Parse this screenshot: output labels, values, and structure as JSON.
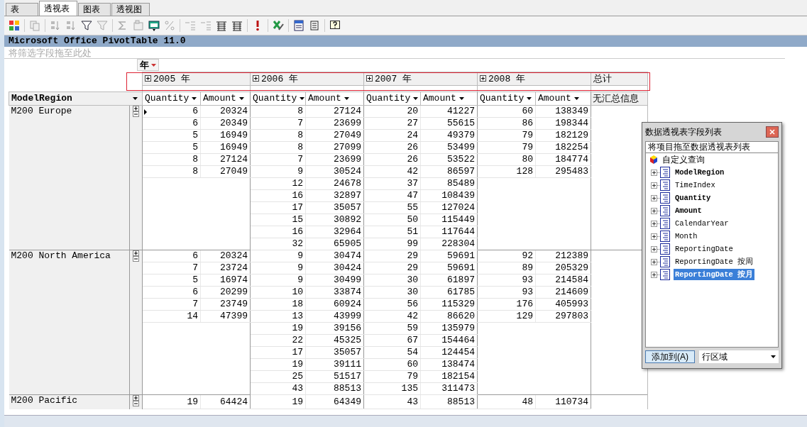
{
  "tabs": [
    {
      "label": "表",
      "selected": false
    },
    {
      "label": "透视表",
      "selected": true
    },
    {
      "label": "图表",
      "selected": false
    },
    {
      "label": "透视图",
      "selected": false
    }
  ],
  "pivot": {
    "title": "Microsoft Office PivotTable 11.0",
    "filter_placeholder": "将筛选字段拖至此处",
    "column_field": "年",
    "years": [
      {
        "label": "2005 年",
        "measures": [
          "Quantity",
          "Amount"
        ]
      },
      {
        "label": "2006 年",
        "measures": [
          "Quantity",
          "Amount"
        ]
      },
      {
        "label": "2007 年",
        "measures": [
          "Quantity",
          "Amount"
        ]
      },
      {
        "label": "2008 年",
        "measures": [
          "Quantity",
          "Amount"
        ]
      }
    ],
    "total_label": "总计",
    "row_field": "ModelRegion",
    "no_total": "无汇总信息",
    "groups": [
      {
        "region": "M200 Europe",
        "rows": [
          [
            [
              "6",
              "20324"
            ],
            [
              "8",
              "27124"
            ],
            [
              "20",
              "41227"
            ],
            [
              "60",
              "138349"
            ]
          ],
          [
            [
              "6",
              "20349"
            ],
            [
              "7",
              "23699"
            ],
            [
              "27",
              "55615"
            ],
            [
              "86",
              "198344"
            ]
          ],
          [
            [
              "5",
              "16949"
            ],
            [
              "8",
              "27049"
            ],
            [
              "24",
              "49379"
            ],
            [
              "79",
              "182129"
            ]
          ],
          [
            [
              "5",
              "16949"
            ],
            [
              "8",
              "27099"
            ],
            [
              "26",
              "53499"
            ],
            [
              "79",
              "182254"
            ]
          ],
          [
            [
              "8",
              "27124"
            ],
            [
              "7",
              "23699"
            ],
            [
              "26",
              "53522"
            ],
            [
              "80",
              "184774"
            ]
          ],
          [
            [
              "8",
              "27049"
            ],
            [
              "9",
              "30524"
            ],
            [
              "42",
              "86597"
            ],
            [
              "128",
              "295483"
            ]
          ],
          [
            null,
            [
              "12",
              "24678"
            ],
            [
              "37",
              "85489"
            ],
            null
          ],
          [
            null,
            [
              "16",
              "32897"
            ],
            [
              "47",
              "108439"
            ],
            null
          ],
          [
            null,
            [
              "17",
              "35057"
            ],
            [
              "55",
              "127024"
            ],
            null
          ],
          [
            null,
            [
              "15",
              "30892"
            ],
            [
              "50",
              "115449"
            ],
            null
          ],
          [
            null,
            [
              "16",
              "32964"
            ],
            [
              "51",
              "117644"
            ],
            null
          ],
          [
            null,
            [
              "32",
              "65905"
            ],
            [
              "99",
              "228304"
            ],
            null
          ]
        ]
      },
      {
        "region": "M200 North America",
        "rows": [
          [
            [
              "6",
              "20324"
            ],
            [
              "9",
              "30474"
            ],
            [
              "29",
              "59691"
            ],
            [
              "92",
              "212389"
            ]
          ],
          [
            [
              "7",
              "23724"
            ],
            [
              "9",
              "30424"
            ],
            [
              "29",
              "59691"
            ],
            [
              "89",
              "205329"
            ]
          ],
          [
            [
              "5",
              "16974"
            ],
            [
              "9",
              "30499"
            ],
            [
              "30",
              "61897"
            ],
            [
              "93",
              "214584"
            ]
          ],
          [
            [
              "6",
              "20299"
            ],
            [
              "10",
              "33874"
            ],
            [
              "30",
              "61785"
            ],
            [
              "93",
              "214609"
            ]
          ],
          [
            [
              "7",
              "23749"
            ],
            [
              "18",
              "60924"
            ],
            [
              "56",
              "115329"
            ],
            [
              "176",
              "405993"
            ]
          ],
          [
            [
              "14",
              "47399"
            ],
            [
              "13",
              "43999"
            ],
            [
              "42",
              "86620"
            ],
            [
              "129",
              "297803"
            ]
          ],
          [
            null,
            [
              "19",
              "39156"
            ],
            [
              "59",
              "135979"
            ],
            null
          ],
          [
            null,
            [
              "22",
              "45325"
            ],
            [
              "67",
              "154464"
            ],
            null
          ],
          [
            null,
            [
              "17",
              "35057"
            ],
            [
              "54",
              "124454"
            ],
            null
          ],
          [
            null,
            [
              "19",
              "39111"
            ],
            [
              "60",
              "138474"
            ],
            null
          ],
          [
            null,
            [
              "25",
              "51517"
            ],
            [
              "79",
              "182154"
            ],
            null
          ],
          [
            null,
            [
              "43",
              "88513"
            ],
            [
              "135",
              "311473"
            ],
            null
          ]
        ]
      },
      {
        "region": "M200 Pacific",
        "rows": [
          [
            [
              "19",
              "64424"
            ],
            [
              "19",
              "64349"
            ],
            [
              "43",
              "88513"
            ],
            [
              "48",
              "110734"
            ]
          ]
        ]
      }
    ]
  },
  "field_list": {
    "title": "数据透视表字段列表",
    "instruction": "将项目拖至数据透视表列表",
    "root": "自定义查询",
    "fields": [
      {
        "label": "ModelRegion",
        "in_use": true,
        "selected": false
      },
      {
        "label": "TimeIndex",
        "in_use": false,
        "selected": false
      },
      {
        "label": "Quantity",
        "in_use": true,
        "selected": false
      },
      {
        "label": "Amount",
        "in_use": true,
        "selected": false
      },
      {
        "label": "CalendarYear",
        "in_use": false,
        "selected": false
      },
      {
        "label": "Month",
        "in_use": false,
        "selected": false
      },
      {
        "label": "ReportingDate",
        "in_use": false,
        "selected": false
      },
      {
        "label": "ReportingDate 按周",
        "in_use": false,
        "selected": false
      },
      {
        "label": "ReportingDate 按月",
        "in_use": true,
        "selected": true
      }
    ],
    "add_button": "添加到(A)",
    "area_select": "行区域"
  }
}
